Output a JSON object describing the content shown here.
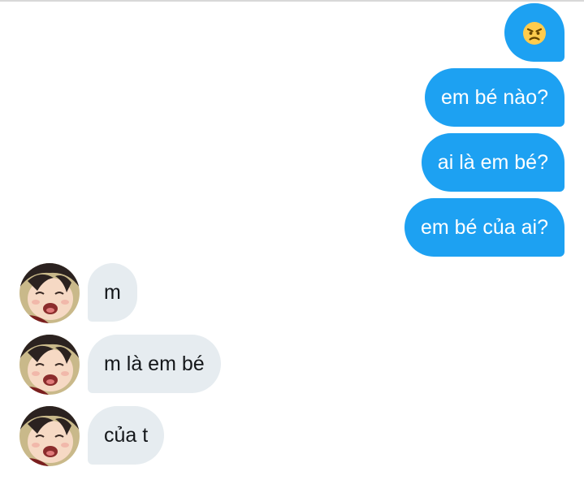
{
  "conversation": {
    "sent_messages": [
      {
        "emoji": "angry-face-emoji"
      },
      {
        "text": "em bé nào?"
      },
      {
        "text": "ai là em bé?"
      },
      {
        "text": "em bé của ai?"
      }
    ],
    "received_messages": [
      {
        "text": "m"
      },
      {
        "text": "m là em bé"
      },
      {
        "text": "của t"
      }
    ],
    "avatar_icon": "anime-character-avatar"
  },
  "colors": {
    "sent_bubble": "#1da1f2",
    "received_bubble": "#e6ecf0",
    "sent_text": "#ffffff",
    "received_text": "#14171a"
  }
}
